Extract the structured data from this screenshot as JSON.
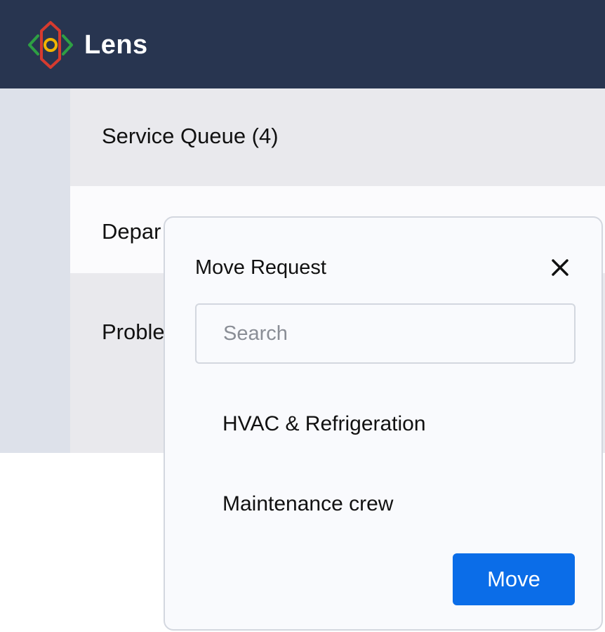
{
  "header": {
    "app_name": "Lens",
    "logo_icon": "lens-logo-icon",
    "background": "#283550"
  },
  "list": {
    "rows": [
      {
        "label": "Service Queue (4)"
      },
      {
        "label": "Depar"
      },
      {
        "label": "Proble"
      }
    ]
  },
  "dialog": {
    "title": "Move Request",
    "close_icon": "close-icon",
    "search": {
      "value": "",
      "placeholder": "Search"
    },
    "options": [
      {
        "label": "HVAC & Refrigeration"
      },
      {
        "label": "Maintenance crew"
      }
    ],
    "move_label": "Move",
    "accent_color": "#0b6de8"
  }
}
